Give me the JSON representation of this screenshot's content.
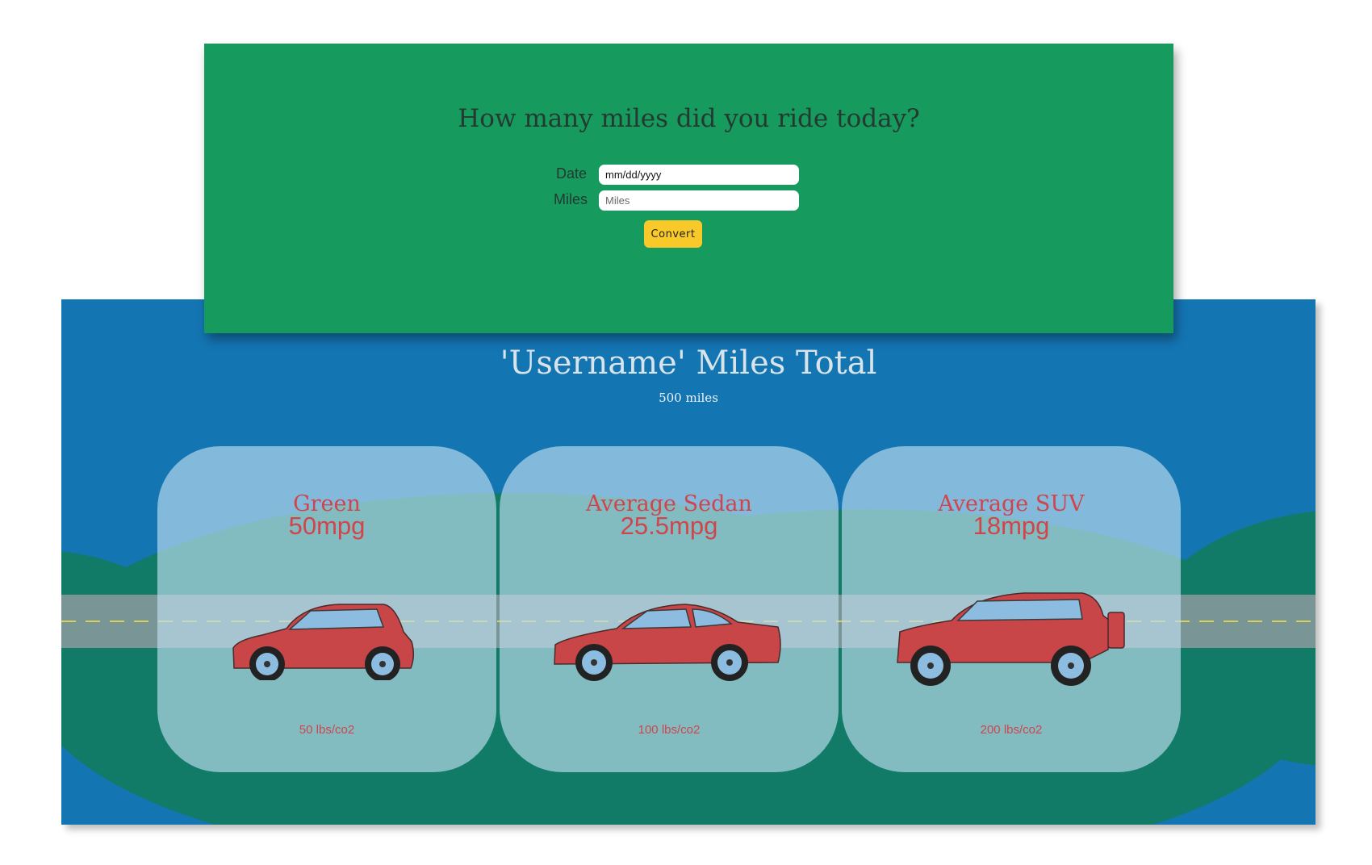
{
  "form": {
    "title": "How many miles did you ride today?",
    "date_label": "Date",
    "date_value": "mm/dd/yyyy",
    "miles_label": "Miles",
    "miles_placeholder": "Miles",
    "convert_label": "Convert"
  },
  "results": {
    "title": "'Username' Miles Total",
    "total": "500 miles"
  },
  "cards": [
    {
      "name": "Green",
      "mpg": "50mpg",
      "co2": "50 lbs/co2"
    },
    {
      "name": "Average Sedan",
      "mpg": "25.5mpg",
      "co2": "100 lbs/co2"
    },
    {
      "name": "Average SUV",
      "mpg": "18mpg",
      "co2": "200 lbs/co2"
    }
  ],
  "colors": {
    "form_bg": "#169a5e",
    "results_bg": "#1475b3",
    "car": "#c84548",
    "button": "#f8c928",
    "card_text": "#d0454c"
  }
}
